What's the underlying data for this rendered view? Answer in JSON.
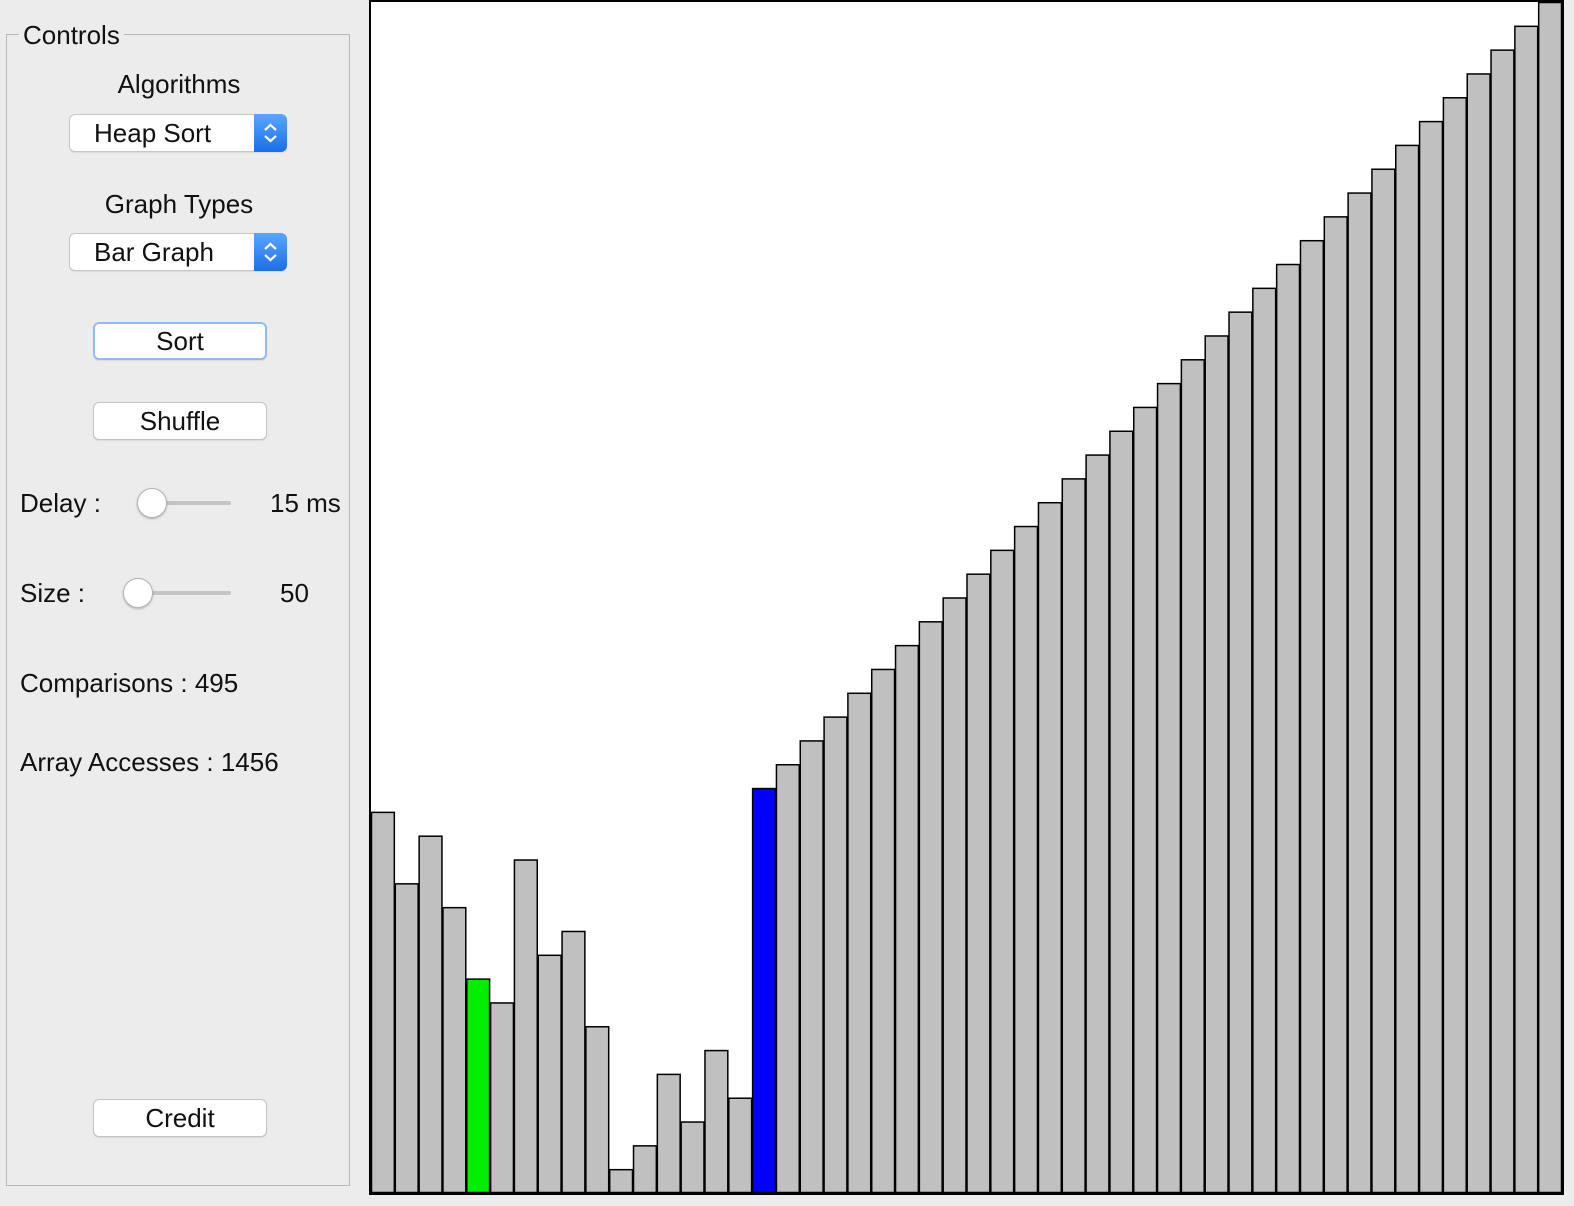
{
  "controls": {
    "title": "Controls",
    "algorithms_label": "Algorithms",
    "algorithm_selected": "Heap Sort",
    "graph_types_label": "Graph Types",
    "graph_type_selected": "Bar Graph",
    "sort_label": "Sort",
    "shuffle_label": "Shuffle",
    "delay_label": "Delay :",
    "delay_value": "15 ms",
    "size_label": "Size :",
    "size_value": "50",
    "comparisons_text": "Comparisons : 495",
    "array_accesses_text": "Array Accesses : 1456",
    "credit_label": "Credit"
  },
  "colors": {
    "bar": "#c0c0c0",
    "bar_outline": "#000000",
    "compare_highlight": "#00ee00",
    "swap_highlight": "#0000ff",
    "accent": "#1a6fe8"
  },
  "chart_data": {
    "type": "bar",
    "ylim": [
      0,
      50
    ],
    "values": [
      16,
      13,
      15,
      12,
      9,
      8,
      14,
      10,
      11,
      7,
      1,
      2,
      5,
      3,
      6,
      4,
      17,
      18,
      19,
      20,
      21,
      22,
      23,
      24,
      25,
      26,
      27,
      28,
      29,
      30,
      31,
      32,
      33,
      34,
      35,
      36,
      37,
      38,
      39,
      40,
      41,
      42,
      43,
      44,
      45,
      46,
      47,
      48,
      49,
      50
    ],
    "highlight": {
      "green_index": 4,
      "blue_index": 16
    }
  }
}
